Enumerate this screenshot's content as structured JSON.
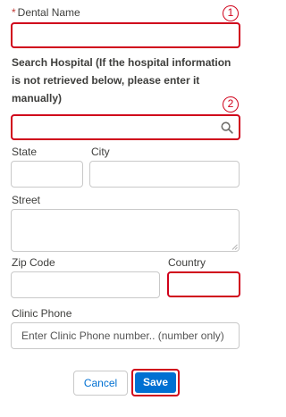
{
  "dental_name": {
    "label": "Dental Name",
    "required_mark": "*",
    "value": "",
    "annotation": "1"
  },
  "hospital_search": {
    "instruction": "Search Hospital (If the hospital information is not retrieved below, please enter it manually)",
    "value": "",
    "annotation": "2",
    "icon": "search-icon"
  },
  "state": {
    "label": "State",
    "value": ""
  },
  "city": {
    "label": "City",
    "value": ""
  },
  "street": {
    "label": "Street",
    "value": ""
  },
  "zip_code": {
    "label": "Zip Code",
    "value": ""
  },
  "country": {
    "label": "Country",
    "value": ""
  },
  "clinic_phone": {
    "label": "Clinic Phone",
    "placeholder": "Enter Clinic Phone number.. (number only)"
  },
  "buttons": {
    "cancel": "Cancel",
    "save": "Save"
  },
  "colors": {
    "highlight": "#d0021b",
    "save_bg": "#0070d2",
    "cancel_text": "#0070d2"
  }
}
